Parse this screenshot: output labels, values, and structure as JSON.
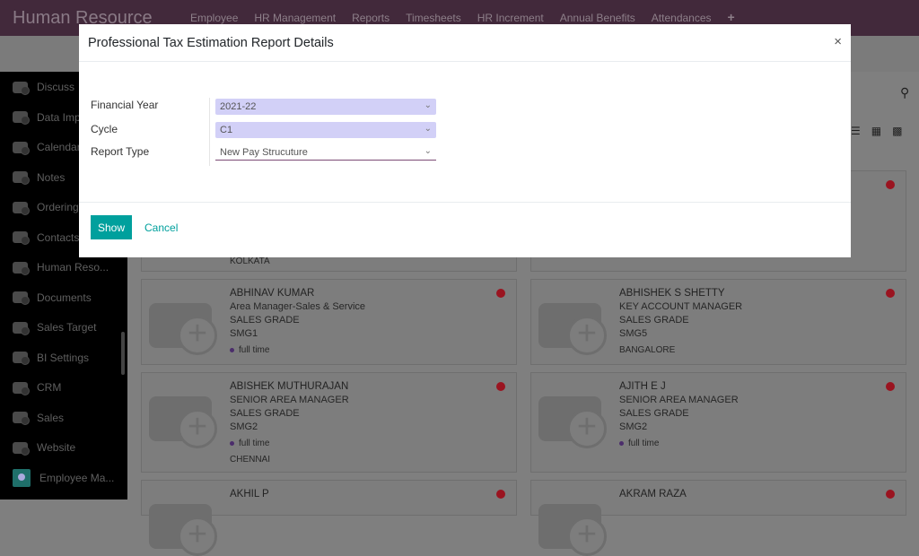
{
  "app": {
    "title": "Human Resource",
    "menu": [
      "Employee",
      "HR Management",
      "Reports",
      "Timesheets",
      "HR Increment",
      "Annual Benefits",
      "Attendances",
      "+"
    ]
  },
  "sidebar": {
    "items": [
      {
        "label": "Discuss",
        "icon": "camera-icon"
      },
      {
        "label": "Data Imp",
        "icon": "camera-icon"
      },
      {
        "label": "Calendar",
        "icon": "camera-icon"
      },
      {
        "label": "Notes",
        "icon": "camera-icon"
      },
      {
        "label": "Ordering",
        "icon": "camera-icon"
      },
      {
        "label": "Contacts",
        "icon": "camera-icon"
      },
      {
        "label": "Human Reso...",
        "icon": "camera-icon"
      },
      {
        "label": "Documents",
        "icon": "camera-icon"
      },
      {
        "label": "Sales Target",
        "icon": "camera-icon"
      },
      {
        "label": "BI Settings",
        "icon": "camera-icon"
      },
      {
        "label": "CRM",
        "icon": "camera-icon"
      },
      {
        "label": "Sales",
        "icon": "camera-icon"
      },
      {
        "label": "Website",
        "icon": "camera-icon"
      },
      {
        "label": "Employee Ma...",
        "icon": "map-pin-icon"
      }
    ]
  },
  "toolbar": {
    "search_icon": "search-icon",
    "views": [
      "list-icon",
      "grid-icon",
      "kanban-icon"
    ]
  },
  "employees": [
    {
      "name": "",
      "lines": [],
      "tag": "",
      "location": "KOLKATA"
    },
    {
      "name": "",
      "lines": [],
      "tag": "",
      "location": ""
    },
    {
      "name": "ABHINAV KUMAR",
      "lines": [
        "Area Manager-Sales & Service",
        "SALES GRADE",
        "SMG1"
      ],
      "tag": "full time",
      "location": ""
    },
    {
      "name": "ABHISHEK S SHETTY",
      "lines": [
        "KEY ACCOUNT MANAGER",
        "SALES GRADE",
        "SMG5"
      ],
      "tag": "",
      "location": "BANGALORE"
    },
    {
      "name": "ABISHEK MUTHURAJAN",
      "lines": [
        "SENIOR AREA MANAGER",
        "SALES GRADE",
        "SMG2"
      ],
      "tag": "full time",
      "location": "CHENNAI"
    },
    {
      "name": "AJITH E J",
      "lines": [
        "SENIOR AREA MANAGER",
        "SALES GRADE",
        "SMG2"
      ],
      "tag": "full time",
      "location": ""
    },
    {
      "name": "AKHIL P",
      "lines": [],
      "tag": "",
      "location": ""
    },
    {
      "name": "AKRAM RAZA",
      "lines": [],
      "tag": "",
      "location": ""
    }
  ],
  "modal": {
    "title": "Professional Tax Estimation Report Details",
    "close": "×",
    "fields": [
      {
        "label": "Financial Year",
        "value": "2021-22"
      },
      {
        "label": "Cycle",
        "value": "C1"
      },
      {
        "label": "Report Type",
        "value": "New Pay Strucuture"
      }
    ],
    "show_label": "Show",
    "cancel_label": "Cancel"
  },
  "colors": {
    "topbar": "#42293b",
    "primary": "#00a09d",
    "status_dot": "#9a1420"
  }
}
